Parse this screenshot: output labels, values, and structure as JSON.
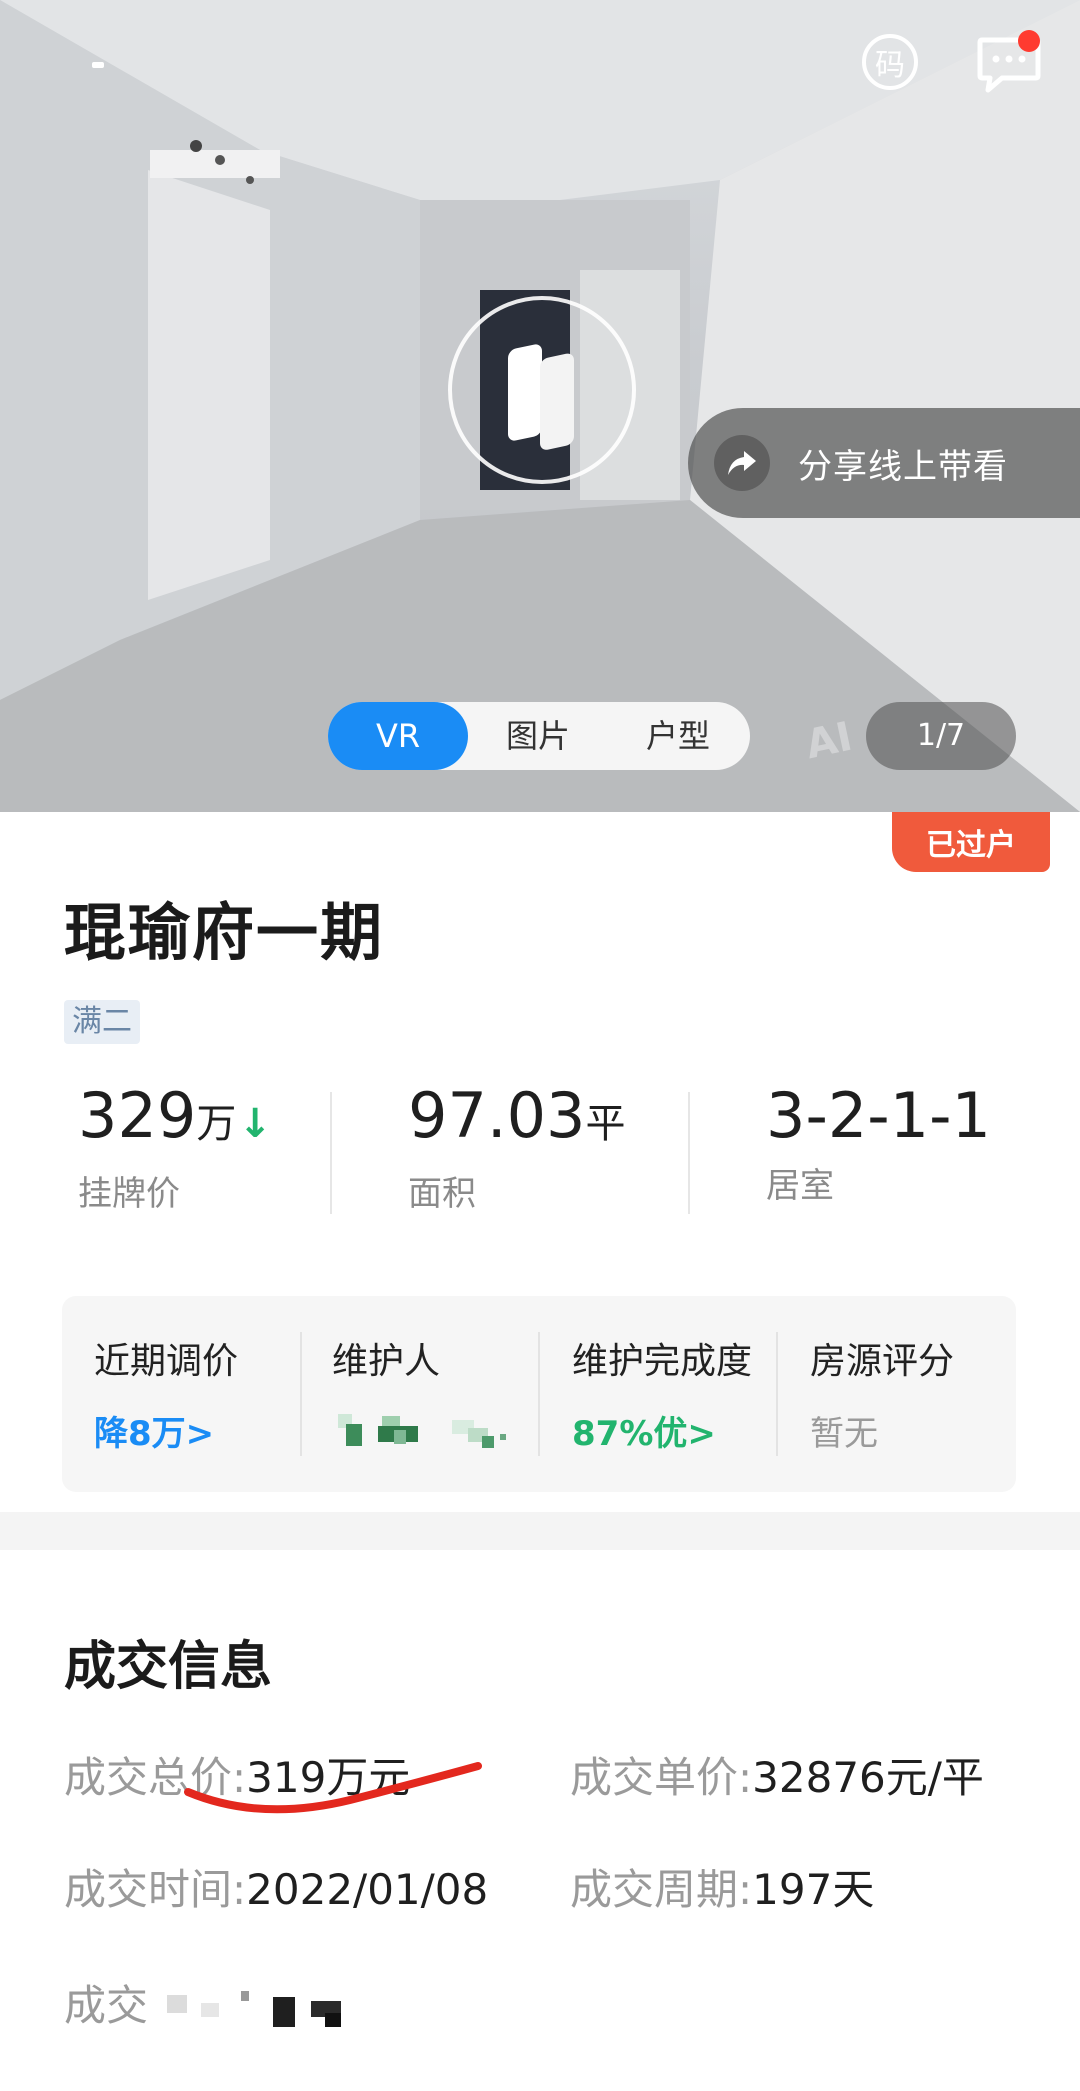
{
  "hero": {
    "qr_label": "码",
    "share_label": "分享线上带看",
    "media_tabs": [
      "VR",
      "图片",
      "户型"
    ],
    "active_tab": "VR",
    "counter": "1/7",
    "watermark": "AI"
  },
  "status_badge": "已过户",
  "listing": {
    "title": "琨瑜府一期",
    "tag": "满二"
  },
  "stats": [
    {
      "value": "329",
      "unit": "万",
      "label": "挂牌价"
    },
    {
      "value": "97.03",
      "unit": "平",
      "label": "面积"
    },
    {
      "value": "3-2-1-1",
      "unit": "",
      "label": "居室"
    }
  ],
  "info_card": {
    "items": [
      {
        "title": "近期调价",
        "value": "降8万>",
        "color": "#1a8cf5"
      },
      {
        "title": "维护人",
        "value": "",
        "color": "#22b46e"
      },
      {
        "title": "维护完成度",
        "value": "87%优>",
        "color": "#22b46e"
      },
      {
        "title": "房源评分",
        "value": "暂无",
        "color": "#9a9a9a"
      }
    ]
  },
  "deal": {
    "section_title": "成交信息",
    "total_price_label": "成交总价:",
    "total_price": "319万元",
    "unit_price_label": "成交单价:",
    "unit_price": "32876元/平",
    "date_label": "成交时间:",
    "date": "2022/01/08",
    "period_label": "成交周期:",
    "period": "197天",
    "partial_label": "成交"
  },
  "colors": {
    "accent_blue": "#1a8cf5",
    "green": "#22b46e",
    "badge": "#f05a3c",
    "annotation_red": "#e3281e"
  }
}
